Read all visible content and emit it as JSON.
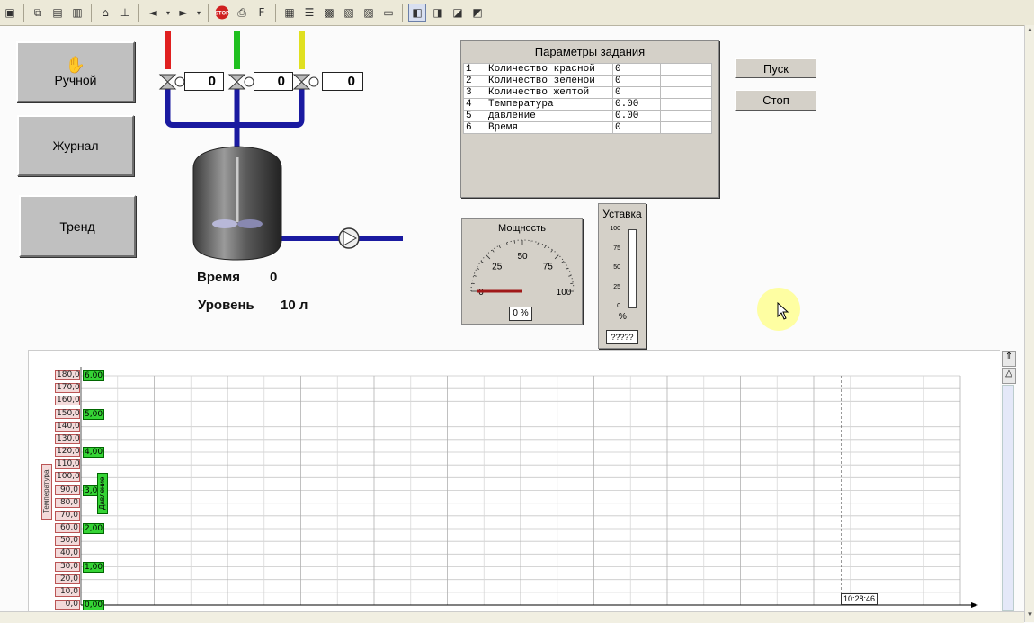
{
  "buttons": {
    "manual": "Ручной",
    "journal": "Журнал",
    "trend": "Тренд",
    "start": "Пуск",
    "stop": "Стоп"
  },
  "valves": [
    {
      "value": "0",
      "color": "#e02020"
    },
    {
      "value": "0",
      "color": "#20c020"
    },
    {
      "value": "0",
      "color": "#e0e020"
    }
  ],
  "tank": {
    "time_label": "Время",
    "time_value": "0",
    "level_label": "Уровень",
    "level_value": "10 л"
  },
  "params": {
    "title": "Параметры задания",
    "rows": [
      {
        "n": "1",
        "name": "Количество красной",
        "value": "0"
      },
      {
        "n": "2",
        "name": "Количество зеленой",
        "value": "0"
      },
      {
        "n": "3",
        "name": "Количество желтой",
        "value": "0"
      },
      {
        "n": "4",
        "name": "Температура",
        "value": "0.00"
      },
      {
        "n": "5",
        "name": "давление",
        "value": "0.00"
      },
      {
        "n": "6",
        "name": "Время",
        "value": "0"
      }
    ]
  },
  "gauge": {
    "title": "Мощность",
    "ticks": [
      "0",
      "25",
      "50",
      "75",
      "100"
    ],
    "readout": "0 %",
    "value_percent": 0
  },
  "setpoint": {
    "title": "Уставка",
    "ticks": [
      "100",
      "75",
      "50",
      "25",
      "0"
    ],
    "unit": "%",
    "readout": "?????",
    "value_percent": 0
  },
  "trend": {
    "left_axis_title": "Температура",
    "right_axis_title": "Давление",
    "left_ticks": [
      "180,0",
      "170,0",
      "160,0",
      "150,0",
      "140,0",
      "130,0",
      "120,0",
      "110,0",
      "100,0",
      "90,0",
      "80,0",
      "70,0",
      "60,0",
      "50,0",
      "40,0",
      "30,0",
      "20,0",
      "10,0",
      "0,0"
    ],
    "right_ticks": [
      "6,00",
      "5,00",
      "4,00",
      "3,00",
      "2,00",
      "1,00",
      "0,00"
    ],
    "time_label": "10:28:46"
  },
  "colors": {
    "pipe": "#1a1aa0",
    "accent_green": "#35d435"
  }
}
